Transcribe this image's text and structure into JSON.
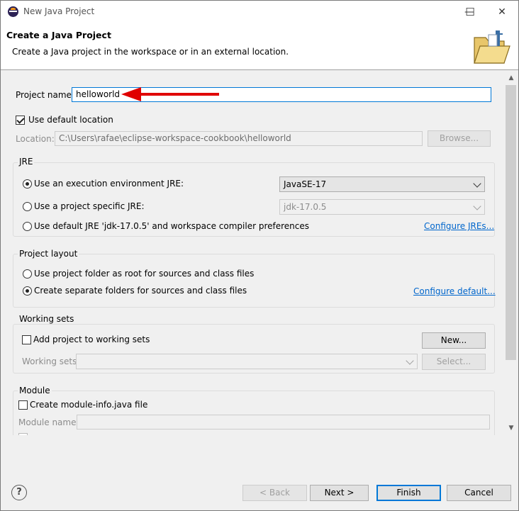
{
  "window": {
    "title": "New Java Project",
    "controls": {
      "minimize": "—",
      "maximize": "☐",
      "close": "✕"
    }
  },
  "header": {
    "title": "Create a Java Project",
    "description": "Create a Java project in the workspace or in an external location."
  },
  "form": {
    "project_name_label": "Project name:",
    "project_name_value": "helloworld",
    "use_default_location_label": "Use default location",
    "use_default_location_checked": true,
    "location_label": "Location:",
    "location_value": "C:\\Users\\rafae\\eclipse-workspace-cookbook\\helloworld",
    "browse_label": "Browse..."
  },
  "jre": {
    "group_title": "JRE",
    "options": [
      {
        "label": "Use an execution environment JRE:",
        "checked": true
      },
      {
        "label": "Use a project specific JRE:",
        "checked": false
      },
      {
        "label": "Use default JRE 'jdk-17.0.5' and workspace compiler preferences",
        "checked": false
      }
    ],
    "execution_env_value": "JavaSE-17",
    "project_jre_value": "jdk-17.0.5",
    "configure_link": "Configure JREs..."
  },
  "project_layout": {
    "group_title": "Project layout",
    "options": [
      {
        "label": "Use project folder as root for sources and class files",
        "checked": false
      },
      {
        "label": "Create separate folders for sources and class files",
        "checked": true
      }
    ],
    "configure_link": "Configure default..."
  },
  "working_sets": {
    "group_title": "Working sets",
    "add_label": "Add project to working sets",
    "add_checked": false,
    "new_button": "New...",
    "working_sets_label": "Working sets:",
    "select_button": "Select..."
  },
  "module": {
    "group_title": "Module",
    "create_label": "Create module-info.java file",
    "create_checked": false,
    "module_name_label": "Module name:"
  },
  "footer": {
    "help_icon": "?",
    "back": "< Back",
    "next": "Next >",
    "finish": "Finish",
    "cancel": "Cancel"
  },
  "colors": {
    "annotation_arrow": "#e00000",
    "link": "#0066cc",
    "focus_border": "#0078d7"
  }
}
